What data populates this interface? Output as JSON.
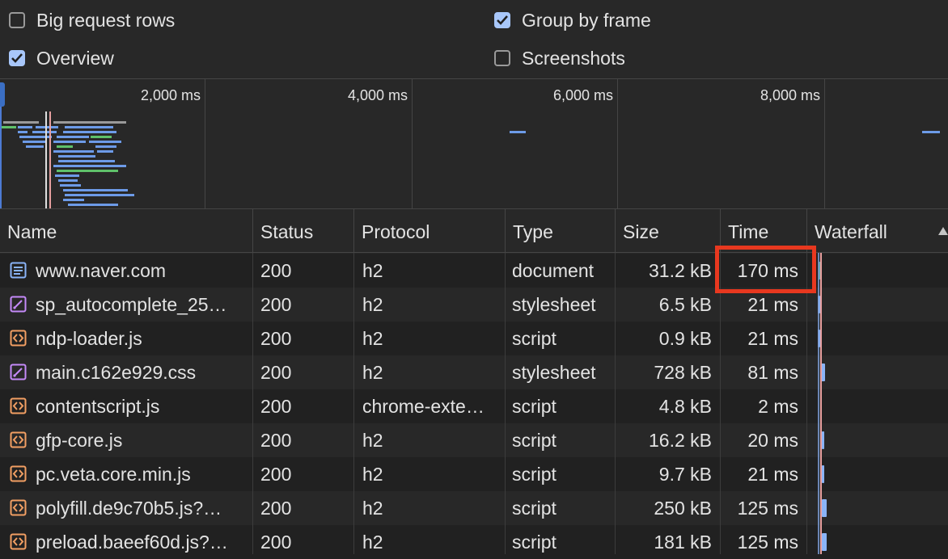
{
  "settings": {
    "big_request_rows": {
      "label": "Big request rows",
      "checked": false
    },
    "overview": {
      "label": "Overview",
      "checked": true
    },
    "group_by_frame": {
      "label": "Group by frame",
      "checked": true
    },
    "screenshots": {
      "label": "Screenshots",
      "checked": false
    }
  },
  "overview": {
    "ticks": [
      "2,000 ms",
      "4,000 ms",
      "6,000 ms",
      "8,000 ms"
    ]
  },
  "table": {
    "columns": [
      "Name",
      "Status",
      "Protocol",
      "Type",
      "Size",
      "Time",
      "Waterfall"
    ],
    "rows": [
      {
        "name": "www.naver.com",
        "icon": "document-icon",
        "status": "200",
        "protocol": "h2",
        "type": "document",
        "size": "31.2 kB",
        "time": "170 ms"
      },
      {
        "name": "sp_autocomplete_25…",
        "icon": "stylesheet-icon",
        "status": "200",
        "protocol": "h2",
        "type": "stylesheet",
        "size": "6.5 kB",
        "time": "21 ms"
      },
      {
        "name": "ndp-loader.js",
        "icon": "script-icon",
        "status": "200",
        "protocol": "h2",
        "type": "script",
        "size": "0.9 kB",
        "time": "21 ms"
      },
      {
        "name": "main.c162e929.css",
        "icon": "stylesheet-icon",
        "status": "200",
        "protocol": "h2",
        "type": "stylesheet",
        "size": "728 kB",
        "time": "81 ms"
      },
      {
        "name": "contentscript.js",
        "icon": "script-icon",
        "status": "200",
        "protocol": "chrome-exte…",
        "type": "script",
        "size": "4.8 kB",
        "time": "2 ms"
      },
      {
        "name": "gfp-core.js",
        "icon": "script-icon",
        "status": "200",
        "protocol": "h2",
        "type": "script",
        "size": "16.2 kB",
        "time": "20 ms"
      },
      {
        "name": "pc.veta.core.min.js",
        "icon": "script-icon",
        "status": "200",
        "protocol": "h2",
        "type": "script",
        "size": "9.7 kB",
        "time": "21 ms"
      },
      {
        "name": "polyfill.de9c70b5.js?…",
        "icon": "script-icon",
        "status": "200",
        "protocol": "h2",
        "type": "script",
        "size": "250 kB",
        "time": "125 ms"
      },
      {
        "name": "preload.baeef60d.js?…",
        "icon": "script-icon",
        "status": "200",
        "protocol": "h2",
        "type": "script",
        "size": "181 kB",
        "time": "125 ms"
      }
    ]
  },
  "colors": {
    "accent": "#a8c7fa",
    "highlight": "#e8381f",
    "stylesheet_icon": "#c58af9",
    "script_icon": "#f29f63",
    "document_icon": "#8ab4f8"
  }
}
